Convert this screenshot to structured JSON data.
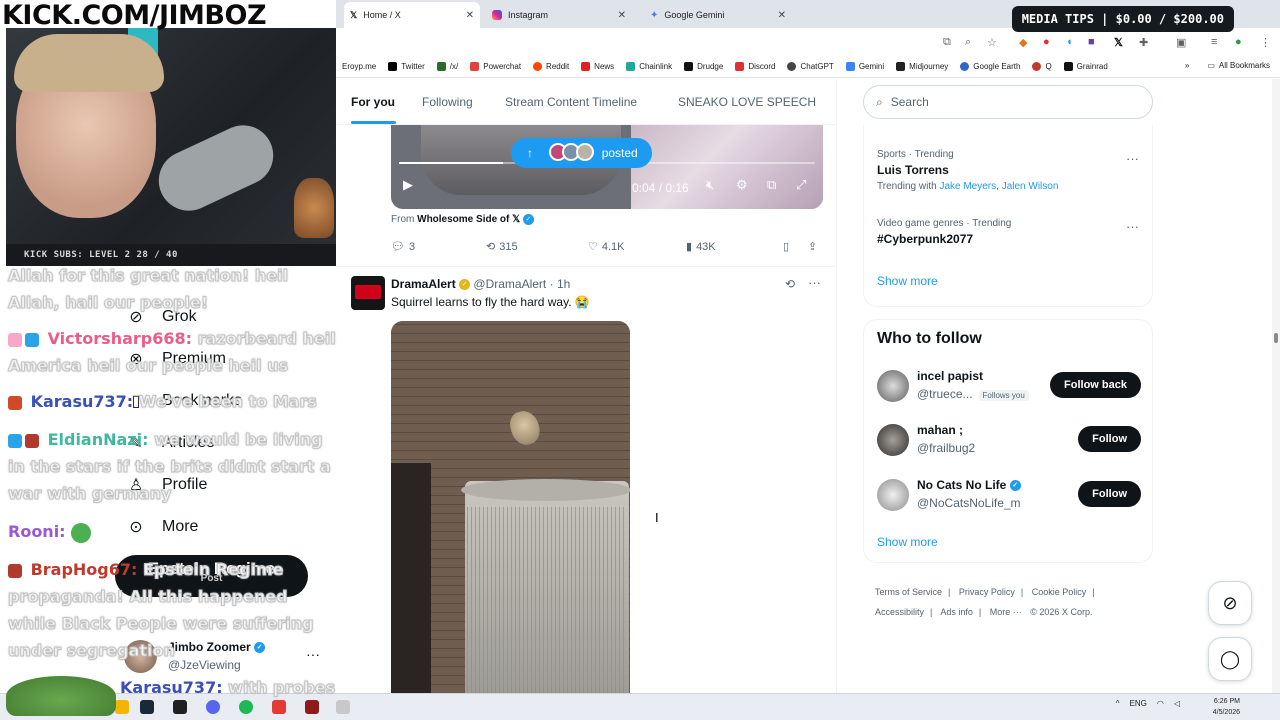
{
  "overlay": {
    "site_title": "KICK.COM/JIMBOZ",
    "media_tips": "MEDIA TIPS | $0.00 / $200.00",
    "subs_goal": "KICK SUBS: LEVEL 2 28 / 40",
    "chat": [
      {
        "user": "",
        "text": "Allah for this great nation! heil Allah, hail our people!"
      },
      {
        "user": "Victorsharp668:",
        "text": "razorbeard heil America heil our people heil us"
      },
      {
        "user": "Karasu737:",
        "text": "We've been to Mars"
      },
      {
        "user": "EldianNazi:",
        "text": "we would be living in the stars if the brits didnt start a war with germany"
      },
      {
        "user": "Rooni:",
        "text": ""
      },
      {
        "user": "BrapHog67:",
        "text": "Epstein Regime propaganda! All this happened while Black People were suffering under segregation"
      },
      {
        "user": "Karasu737:",
        "text": "with probes"
      }
    ],
    "user_colors": {
      "victorsharp": "#e85d8a",
      "karasu": "#3a4fb8",
      "eldian": "#3fb8a0",
      "rooni": "#9b59d0",
      "braphog": "#c0392b"
    }
  },
  "browser": {
    "tabs": [
      {
        "label": "Home / X",
        "icon": "x-icon",
        "active": true
      },
      {
        "label": "Instagram",
        "icon": "instagram-icon",
        "active": false
      },
      {
        "label": "Google Gemini",
        "icon": "gemini-icon",
        "active": false
      }
    ],
    "bookmarks": [
      "Eroyp.me",
      "Twitter",
      "/x/",
      "Powerchat",
      "Reddit",
      "News",
      "Chainlink",
      "Drudge",
      "Discord",
      "ChatGPT",
      "Gemini",
      "Midjourney",
      "Google Earth",
      "Q",
      "Grainrad"
    ],
    "all_bookmarks": "All Bookmarks"
  },
  "x": {
    "feed_tabs": [
      "For you",
      "Following",
      "Stream Content Timeline",
      "SNEAKO LOVE SPEECH"
    ],
    "nav": [
      "Grok",
      "Premium",
      "Bookmarks",
      "Articles",
      "Profile",
      "More"
    ],
    "post_button": "Post",
    "post_overlay_text": "Epstein Regime",
    "account": {
      "name": "Jimbo Zoomer",
      "handle": "@JzeViewing"
    },
    "video": {
      "time": "0:04 / 0:16",
      "progress": 0.25,
      "posted_label": "posted"
    },
    "from_line": {
      "prefix": "From",
      "source": "Wholesome Side of 𝕏"
    },
    "post1_actions": {
      "replies": "3",
      "reposts": "315",
      "likes": "4.1K",
      "views": "43K"
    },
    "post2": {
      "name": "DramaAlert",
      "handle": "@DramaAlert",
      "time": "1h",
      "text": "Squirrel learns to fly the hard way. 😭"
    },
    "search_placeholder": "Search",
    "trends": [
      {
        "meta": "Sports · Trending",
        "name": "Luis Torrens",
        "with_prefix": "Trending with",
        "with": [
          "Jake Meyers",
          "Jalen Wilson"
        ]
      },
      {
        "meta": "Video game genres · Trending",
        "name": "#Cyberpunk2077",
        "with_prefix": "",
        "with": []
      }
    ],
    "trends_show_more": "Show more",
    "who_to_follow": {
      "title": "Who to follow",
      "users": [
        {
          "name": "incel papist",
          "handle": "@truece...",
          "badge": "Follows you",
          "button": "Follow back",
          "verified": false
        },
        {
          "name": "mahan ;",
          "handle": "@frailbug2",
          "badge": "",
          "button": "Follow",
          "verified": false
        },
        {
          "name": "No Cats No Life",
          "handle": "@NoCatsNoLife_m",
          "badge": "",
          "button": "Follow",
          "verified": true
        }
      ],
      "show_more": "Show more"
    },
    "footer": [
      "Terms of Service",
      "|",
      "Privacy Policy",
      "|",
      "Cookie Policy",
      "|",
      "Accessibility",
      "|",
      "Ads info",
      "|",
      "More ···",
      "© 2026 X Corp."
    ]
  },
  "taskbar": {
    "lang": "ENG",
    "time": "6:26 PM",
    "date": "4/5/2026"
  }
}
